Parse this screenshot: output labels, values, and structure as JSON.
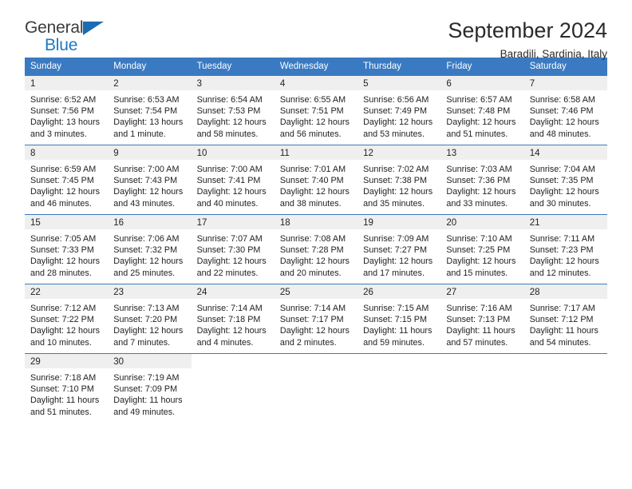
{
  "logo": {
    "line1": "General",
    "line2": "Blue",
    "triangle_icon": "logo-triangle-icon",
    "colors": {
      "general": "#3c3c3c",
      "blue": "#1b79c4",
      "triangle": "#1b6cb3"
    }
  },
  "header": {
    "month_title": "September 2024",
    "location": "Baradili, Sardinia, Italy"
  },
  "theme": {
    "header_blue": "#3a7ac2",
    "daynum_gray": "#efefef",
    "text": "#222222"
  },
  "calendar": {
    "weekday_headers": [
      "Sunday",
      "Monday",
      "Tuesday",
      "Wednesday",
      "Thursday",
      "Friday",
      "Saturday"
    ],
    "weeks": [
      [
        {
          "day": "1",
          "sunrise": "Sunrise: 6:52 AM",
          "sunset": "Sunset: 7:56 PM",
          "daylight1": "Daylight: 13 hours",
          "daylight2": "and 3 minutes."
        },
        {
          "day": "2",
          "sunrise": "Sunrise: 6:53 AM",
          "sunset": "Sunset: 7:54 PM",
          "daylight1": "Daylight: 13 hours",
          "daylight2": "and 1 minute."
        },
        {
          "day": "3",
          "sunrise": "Sunrise: 6:54 AM",
          "sunset": "Sunset: 7:53 PM",
          "daylight1": "Daylight: 12 hours",
          "daylight2": "and 58 minutes."
        },
        {
          "day": "4",
          "sunrise": "Sunrise: 6:55 AM",
          "sunset": "Sunset: 7:51 PM",
          "daylight1": "Daylight: 12 hours",
          "daylight2": "and 56 minutes."
        },
        {
          "day": "5",
          "sunrise": "Sunrise: 6:56 AM",
          "sunset": "Sunset: 7:49 PM",
          "daylight1": "Daylight: 12 hours",
          "daylight2": "and 53 minutes."
        },
        {
          "day": "6",
          "sunrise": "Sunrise: 6:57 AM",
          "sunset": "Sunset: 7:48 PM",
          "daylight1": "Daylight: 12 hours",
          "daylight2": "and 51 minutes."
        },
        {
          "day": "7",
          "sunrise": "Sunrise: 6:58 AM",
          "sunset": "Sunset: 7:46 PM",
          "daylight1": "Daylight: 12 hours",
          "daylight2": "and 48 minutes."
        }
      ],
      [
        {
          "day": "8",
          "sunrise": "Sunrise: 6:59 AM",
          "sunset": "Sunset: 7:45 PM",
          "daylight1": "Daylight: 12 hours",
          "daylight2": "and 46 minutes."
        },
        {
          "day": "9",
          "sunrise": "Sunrise: 7:00 AM",
          "sunset": "Sunset: 7:43 PM",
          "daylight1": "Daylight: 12 hours",
          "daylight2": "and 43 minutes."
        },
        {
          "day": "10",
          "sunrise": "Sunrise: 7:00 AM",
          "sunset": "Sunset: 7:41 PM",
          "daylight1": "Daylight: 12 hours",
          "daylight2": "and 40 minutes."
        },
        {
          "day": "11",
          "sunrise": "Sunrise: 7:01 AM",
          "sunset": "Sunset: 7:40 PM",
          "daylight1": "Daylight: 12 hours",
          "daylight2": "and 38 minutes."
        },
        {
          "day": "12",
          "sunrise": "Sunrise: 7:02 AM",
          "sunset": "Sunset: 7:38 PM",
          "daylight1": "Daylight: 12 hours",
          "daylight2": "and 35 minutes."
        },
        {
          "day": "13",
          "sunrise": "Sunrise: 7:03 AM",
          "sunset": "Sunset: 7:36 PM",
          "daylight1": "Daylight: 12 hours",
          "daylight2": "and 33 minutes."
        },
        {
          "day": "14",
          "sunrise": "Sunrise: 7:04 AM",
          "sunset": "Sunset: 7:35 PM",
          "daylight1": "Daylight: 12 hours",
          "daylight2": "and 30 minutes."
        }
      ],
      [
        {
          "day": "15",
          "sunrise": "Sunrise: 7:05 AM",
          "sunset": "Sunset: 7:33 PM",
          "daylight1": "Daylight: 12 hours",
          "daylight2": "and 28 minutes."
        },
        {
          "day": "16",
          "sunrise": "Sunrise: 7:06 AM",
          "sunset": "Sunset: 7:32 PM",
          "daylight1": "Daylight: 12 hours",
          "daylight2": "and 25 minutes."
        },
        {
          "day": "17",
          "sunrise": "Sunrise: 7:07 AM",
          "sunset": "Sunset: 7:30 PM",
          "daylight1": "Daylight: 12 hours",
          "daylight2": "and 22 minutes."
        },
        {
          "day": "18",
          "sunrise": "Sunrise: 7:08 AM",
          "sunset": "Sunset: 7:28 PM",
          "daylight1": "Daylight: 12 hours",
          "daylight2": "and 20 minutes."
        },
        {
          "day": "19",
          "sunrise": "Sunrise: 7:09 AM",
          "sunset": "Sunset: 7:27 PM",
          "daylight1": "Daylight: 12 hours",
          "daylight2": "and 17 minutes."
        },
        {
          "day": "20",
          "sunrise": "Sunrise: 7:10 AM",
          "sunset": "Sunset: 7:25 PM",
          "daylight1": "Daylight: 12 hours",
          "daylight2": "and 15 minutes."
        },
        {
          "day": "21",
          "sunrise": "Sunrise: 7:11 AM",
          "sunset": "Sunset: 7:23 PM",
          "daylight1": "Daylight: 12 hours",
          "daylight2": "and 12 minutes."
        }
      ],
      [
        {
          "day": "22",
          "sunrise": "Sunrise: 7:12 AM",
          "sunset": "Sunset: 7:22 PM",
          "daylight1": "Daylight: 12 hours",
          "daylight2": "and 10 minutes."
        },
        {
          "day": "23",
          "sunrise": "Sunrise: 7:13 AM",
          "sunset": "Sunset: 7:20 PM",
          "daylight1": "Daylight: 12 hours",
          "daylight2": "and 7 minutes."
        },
        {
          "day": "24",
          "sunrise": "Sunrise: 7:14 AM",
          "sunset": "Sunset: 7:18 PM",
          "daylight1": "Daylight: 12 hours",
          "daylight2": "and 4 minutes."
        },
        {
          "day": "25",
          "sunrise": "Sunrise: 7:14 AM",
          "sunset": "Sunset: 7:17 PM",
          "daylight1": "Daylight: 12 hours",
          "daylight2": "and 2 minutes."
        },
        {
          "day": "26",
          "sunrise": "Sunrise: 7:15 AM",
          "sunset": "Sunset: 7:15 PM",
          "daylight1": "Daylight: 11 hours",
          "daylight2": "and 59 minutes."
        },
        {
          "day": "27",
          "sunrise": "Sunrise: 7:16 AM",
          "sunset": "Sunset: 7:13 PM",
          "daylight1": "Daylight: 11 hours",
          "daylight2": "and 57 minutes."
        },
        {
          "day": "28",
          "sunrise": "Sunrise: 7:17 AM",
          "sunset": "Sunset: 7:12 PM",
          "daylight1": "Daylight: 11 hours",
          "daylight2": "and 54 minutes."
        }
      ],
      [
        {
          "day": "29",
          "sunrise": "Sunrise: 7:18 AM",
          "sunset": "Sunset: 7:10 PM",
          "daylight1": "Daylight: 11 hours",
          "daylight2": "and 51 minutes."
        },
        {
          "day": "30",
          "sunrise": "Sunrise: 7:19 AM",
          "sunset": "Sunset: 7:09 PM",
          "daylight1": "Daylight: 11 hours",
          "daylight2": "and 49 minutes."
        },
        {
          "day": "",
          "sunrise": "",
          "sunset": "",
          "daylight1": "",
          "daylight2": ""
        },
        {
          "day": "",
          "sunrise": "",
          "sunset": "",
          "daylight1": "",
          "daylight2": ""
        },
        {
          "day": "",
          "sunrise": "",
          "sunset": "",
          "daylight1": "",
          "daylight2": ""
        },
        {
          "day": "",
          "sunrise": "",
          "sunset": "",
          "daylight1": "",
          "daylight2": ""
        },
        {
          "day": "",
          "sunrise": "",
          "sunset": "",
          "daylight1": "",
          "daylight2": ""
        }
      ]
    ]
  }
}
